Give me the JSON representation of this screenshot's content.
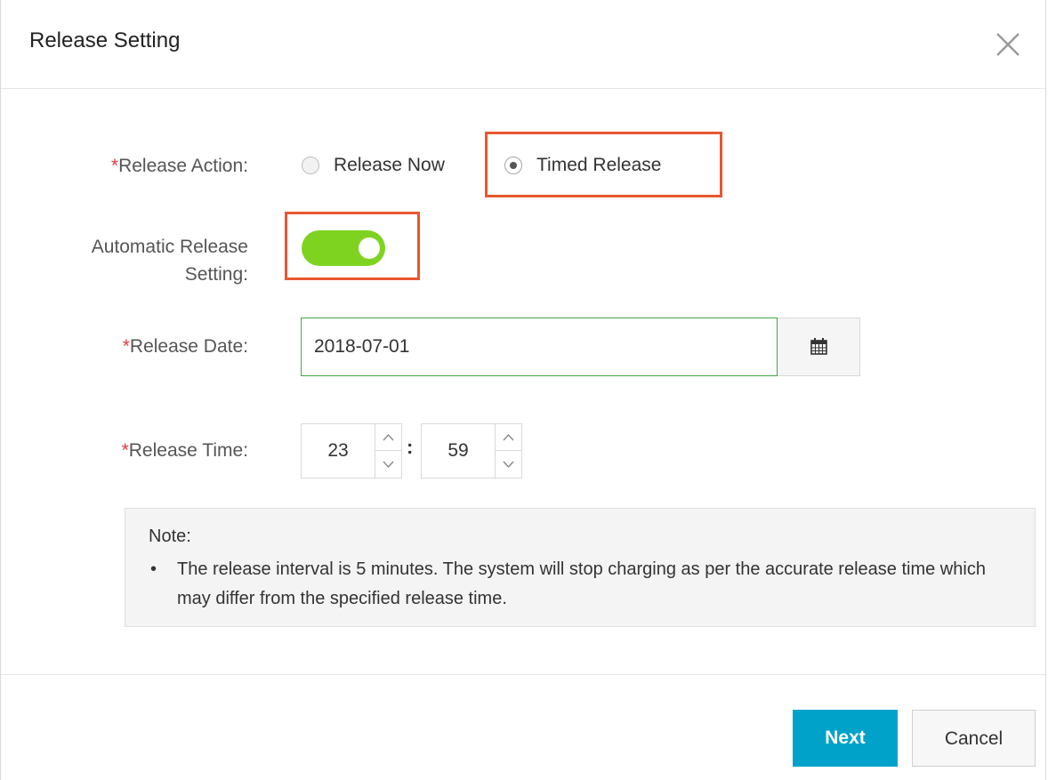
{
  "dialog": {
    "title": "Release Setting"
  },
  "form": {
    "release_action": {
      "label": "Release Action:",
      "required_mark": "*",
      "options": [
        {
          "label": "Release Now",
          "checked": false
        },
        {
          "label": "Timed Release",
          "checked": true
        }
      ]
    },
    "auto_release": {
      "label_line1": "Automatic Release",
      "label_line2": "Setting:",
      "enabled": true
    },
    "release_date": {
      "label": "Release Date:",
      "required_mark": "*",
      "value": "2018-07-01"
    },
    "release_time": {
      "label": "Release Time:",
      "required_mark": "*",
      "hour": "23",
      "minute": "59",
      "separator": ":"
    }
  },
  "note": {
    "title": "Note:",
    "bullet": "•",
    "text": "The release interval is 5 minutes. The system will stop charging as per the accurate release time which may differ from the specified release time."
  },
  "footer": {
    "next_label": "Next",
    "cancel_label": "Cancel"
  },
  "colors": {
    "primary": "#00a2ca",
    "toggle_on": "#7ed321",
    "required": "#e4393c",
    "highlight": "#e8572f",
    "date_border": "#45a545"
  }
}
